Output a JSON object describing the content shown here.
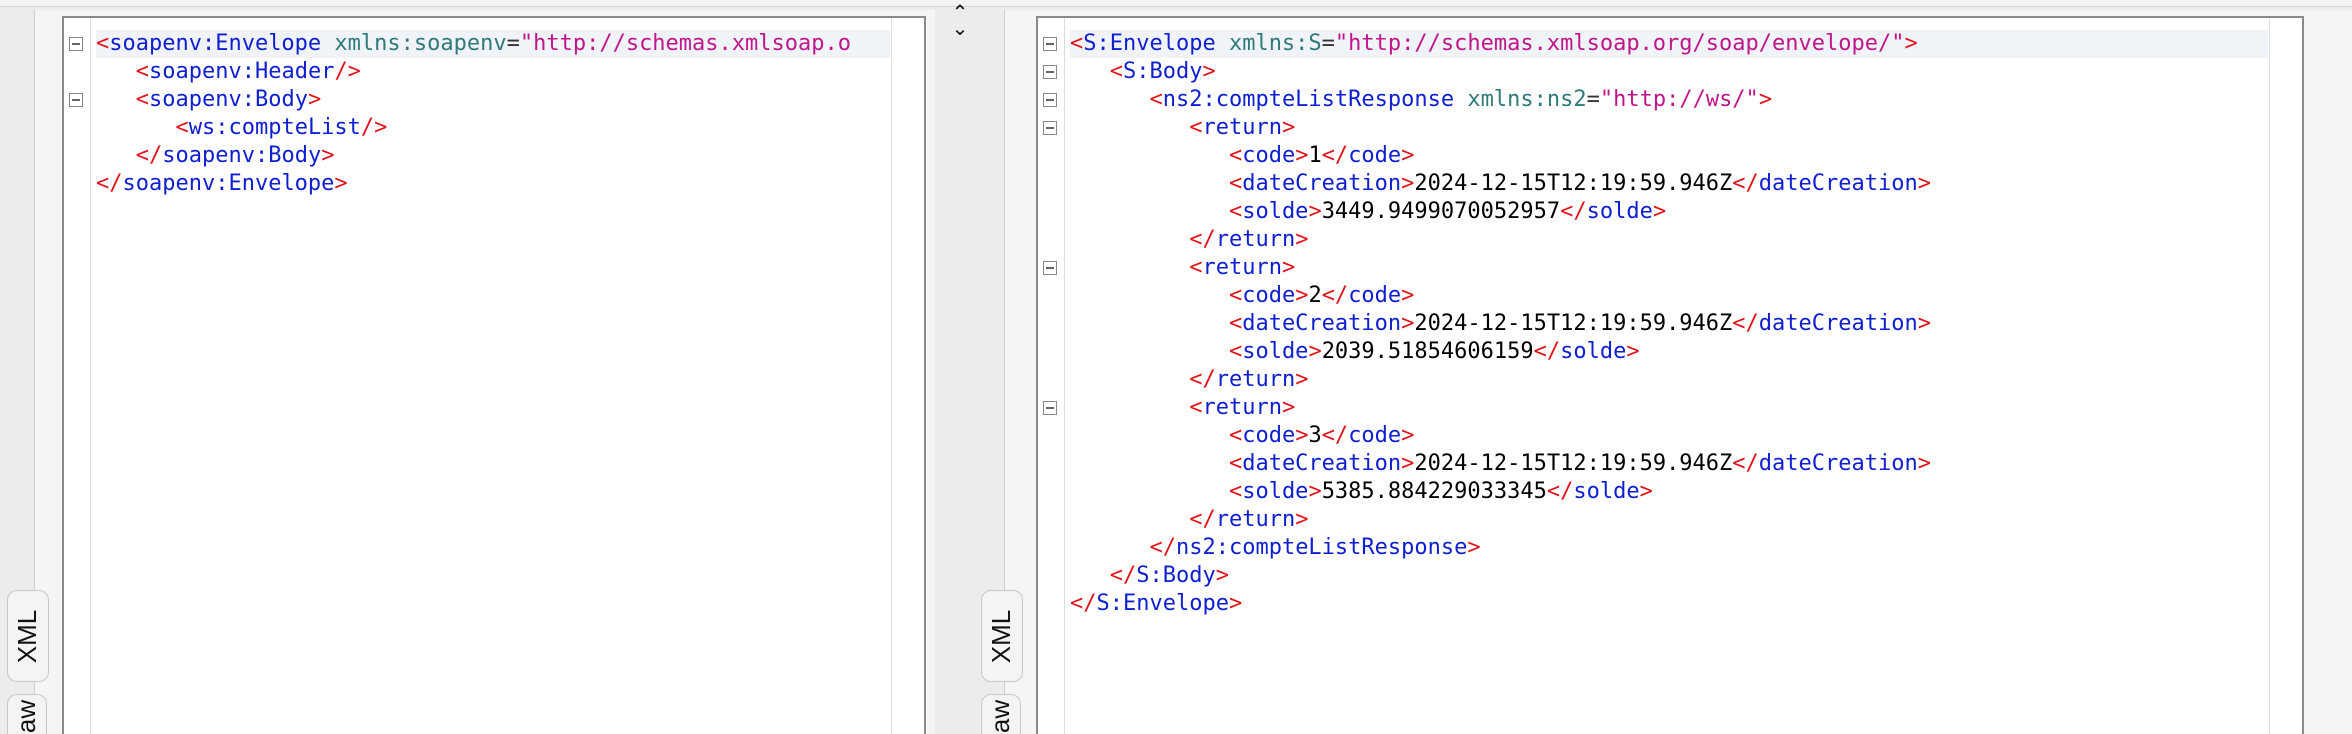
{
  "request": {
    "tabs": [
      {
        "label": "XML"
      },
      {
        "label": "aw"
      }
    ],
    "lines": [
      {
        "indent": "",
        "tokens": [
          [
            "br",
            "<"
          ],
          [
            "tag",
            "soapenv:Envelope"
          ],
          [
            "sp",
            " "
          ],
          [
            "attr",
            "xmlns:soapenv"
          ],
          [
            "eq",
            "="
          ],
          [
            "val",
            "\"http://schemas.xmlsoap.o"
          ]
        ],
        "fold": true,
        "highlight": true
      },
      {
        "indent": "   ",
        "tokens": [
          [
            "br",
            "<"
          ],
          [
            "tag",
            "soapenv:Header"
          ],
          [
            "br",
            "/>"
          ]
        ],
        "fold": false
      },
      {
        "indent": "   ",
        "tokens": [
          [
            "br",
            "<"
          ],
          [
            "tag",
            "soapenv:Body"
          ],
          [
            "br",
            ">"
          ]
        ],
        "fold": true
      },
      {
        "indent": "      ",
        "tokens": [
          [
            "br",
            "<"
          ],
          [
            "tag",
            "ws:compteList"
          ],
          [
            "br",
            "/>"
          ]
        ],
        "fold": false
      },
      {
        "indent": "   ",
        "tokens": [
          [
            "br",
            "</"
          ],
          [
            "tag",
            "soapenv:Body"
          ],
          [
            "br",
            ">"
          ]
        ],
        "fold": false
      },
      {
        "indent": "",
        "tokens": [
          [
            "br",
            "</"
          ],
          [
            "tag",
            "soapenv:Envelope"
          ],
          [
            "br",
            ">"
          ]
        ],
        "fold": false
      }
    ]
  },
  "response": {
    "tabs": [
      {
        "label": "XML"
      },
      {
        "label": "aw"
      }
    ],
    "lines": [
      {
        "indent": "",
        "tokens": [
          [
            "br",
            "<"
          ],
          [
            "tag",
            "S:Envelope"
          ],
          [
            "sp",
            " "
          ],
          [
            "attr",
            "xmlns:S"
          ],
          [
            "eq",
            "="
          ],
          [
            "val",
            "\"http://schemas.xmlsoap.org/soap/envelope/\""
          ],
          [
            "br",
            ">"
          ]
        ],
        "fold": true,
        "highlight": true
      },
      {
        "indent": "   ",
        "tokens": [
          [
            "br",
            "<"
          ],
          [
            "tag",
            "S:Body"
          ],
          [
            "br",
            ">"
          ]
        ],
        "fold": true
      },
      {
        "indent": "      ",
        "tokens": [
          [
            "br",
            "<"
          ],
          [
            "tag",
            "ns2:compteListResponse"
          ],
          [
            "sp",
            " "
          ],
          [
            "attr",
            "xmlns:ns2"
          ],
          [
            "eq",
            "="
          ],
          [
            "val",
            "\"http://ws/\""
          ],
          [
            "br",
            ">"
          ]
        ],
        "fold": true
      },
      {
        "indent": "         ",
        "tokens": [
          [
            "br",
            "<"
          ],
          [
            "tag",
            "return"
          ],
          [
            "br",
            ">"
          ]
        ],
        "fold": true
      },
      {
        "indent": "            ",
        "tokens": [
          [
            "br",
            "<"
          ],
          [
            "tag",
            "code"
          ],
          [
            "br",
            ">"
          ],
          [
            "text",
            "1"
          ],
          [
            "br",
            "</"
          ],
          [
            "tag",
            "code"
          ],
          [
            "br",
            ">"
          ]
        ],
        "fold": false
      },
      {
        "indent": "            ",
        "tokens": [
          [
            "br",
            "<"
          ],
          [
            "tag",
            "dateCreation"
          ],
          [
            "br",
            ">"
          ],
          [
            "text",
            "2024-12-15T12:19:59.946Z"
          ],
          [
            "br",
            "</"
          ],
          [
            "tag",
            "dateCreation"
          ],
          [
            "br",
            ">"
          ]
        ],
        "fold": false
      },
      {
        "indent": "            ",
        "tokens": [
          [
            "br",
            "<"
          ],
          [
            "tag",
            "solde"
          ],
          [
            "br",
            ">"
          ],
          [
            "text",
            "3449.9499070052957"
          ],
          [
            "br",
            "</"
          ],
          [
            "tag",
            "solde"
          ],
          [
            "br",
            ">"
          ]
        ],
        "fold": false
      },
      {
        "indent": "         ",
        "tokens": [
          [
            "br",
            "</"
          ],
          [
            "tag",
            "return"
          ],
          [
            "br",
            ">"
          ]
        ],
        "fold": false
      },
      {
        "indent": "         ",
        "tokens": [
          [
            "br",
            "<"
          ],
          [
            "tag",
            "return"
          ],
          [
            "br",
            ">"
          ]
        ],
        "fold": true
      },
      {
        "indent": "            ",
        "tokens": [
          [
            "br",
            "<"
          ],
          [
            "tag",
            "code"
          ],
          [
            "br",
            ">"
          ],
          [
            "text",
            "2"
          ],
          [
            "br",
            "</"
          ],
          [
            "tag",
            "code"
          ],
          [
            "br",
            ">"
          ]
        ],
        "fold": false
      },
      {
        "indent": "            ",
        "tokens": [
          [
            "br",
            "<"
          ],
          [
            "tag",
            "dateCreation"
          ],
          [
            "br",
            ">"
          ],
          [
            "text",
            "2024-12-15T12:19:59.946Z"
          ],
          [
            "br",
            "</"
          ],
          [
            "tag",
            "dateCreation"
          ],
          [
            "br",
            ">"
          ]
        ],
        "fold": false
      },
      {
        "indent": "            ",
        "tokens": [
          [
            "br",
            "<"
          ],
          [
            "tag",
            "solde"
          ],
          [
            "br",
            ">"
          ],
          [
            "text",
            "2039.51854606159"
          ],
          [
            "br",
            "</"
          ],
          [
            "tag",
            "solde"
          ],
          [
            "br",
            ">"
          ]
        ],
        "fold": false
      },
      {
        "indent": "         ",
        "tokens": [
          [
            "br",
            "</"
          ],
          [
            "tag",
            "return"
          ],
          [
            "br",
            ">"
          ]
        ],
        "fold": false
      },
      {
        "indent": "         ",
        "tokens": [
          [
            "br",
            "<"
          ],
          [
            "tag",
            "return"
          ],
          [
            "br",
            ">"
          ]
        ],
        "fold": true
      },
      {
        "indent": "            ",
        "tokens": [
          [
            "br",
            "<"
          ],
          [
            "tag",
            "code"
          ],
          [
            "br",
            ">"
          ],
          [
            "text",
            "3"
          ],
          [
            "br",
            "</"
          ],
          [
            "tag",
            "code"
          ],
          [
            "br",
            ">"
          ]
        ],
        "fold": false
      },
      {
        "indent": "            ",
        "tokens": [
          [
            "br",
            "<"
          ],
          [
            "tag",
            "dateCreation"
          ],
          [
            "br",
            ">"
          ],
          [
            "text",
            "2024-12-15T12:19:59.946Z"
          ],
          [
            "br",
            "</"
          ],
          [
            "tag",
            "dateCreation"
          ],
          [
            "br",
            ">"
          ]
        ],
        "fold": false
      },
      {
        "indent": "            ",
        "tokens": [
          [
            "br",
            "<"
          ],
          [
            "tag",
            "solde"
          ],
          [
            "br",
            ">"
          ],
          [
            "text",
            "5385.884229033345"
          ],
          [
            "br",
            "</"
          ],
          [
            "tag",
            "solde"
          ],
          [
            "br",
            ">"
          ]
        ],
        "fold": false
      },
      {
        "indent": "         ",
        "tokens": [
          [
            "br",
            "</"
          ],
          [
            "tag",
            "return"
          ],
          [
            "br",
            ">"
          ]
        ],
        "fold": false
      },
      {
        "indent": "      ",
        "tokens": [
          [
            "br",
            "</"
          ],
          [
            "tag",
            "ns2:compteListResponse"
          ],
          [
            "br",
            ">"
          ]
        ],
        "fold": false
      },
      {
        "indent": "   ",
        "tokens": [
          [
            "br",
            "</"
          ],
          [
            "tag",
            "S:Body"
          ],
          [
            "br",
            ">"
          ]
        ],
        "fold": false
      },
      {
        "indent": "",
        "tokens": [
          [
            "br",
            "</"
          ],
          [
            "tag",
            "S:Envelope"
          ],
          [
            "br",
            ">"
          ]
        ],
        "fold": false
      }
    ]
  },
  "splitter": {
    "icon": "collapse-arrows-icon"
  },
  "colors": {
    "bracket": "#e0131a",
    "tag": "#1020d0",
    "attribute": "#2f7a7a",
    "value": "#c0168a",
    "text": "#000000"
  }
}
